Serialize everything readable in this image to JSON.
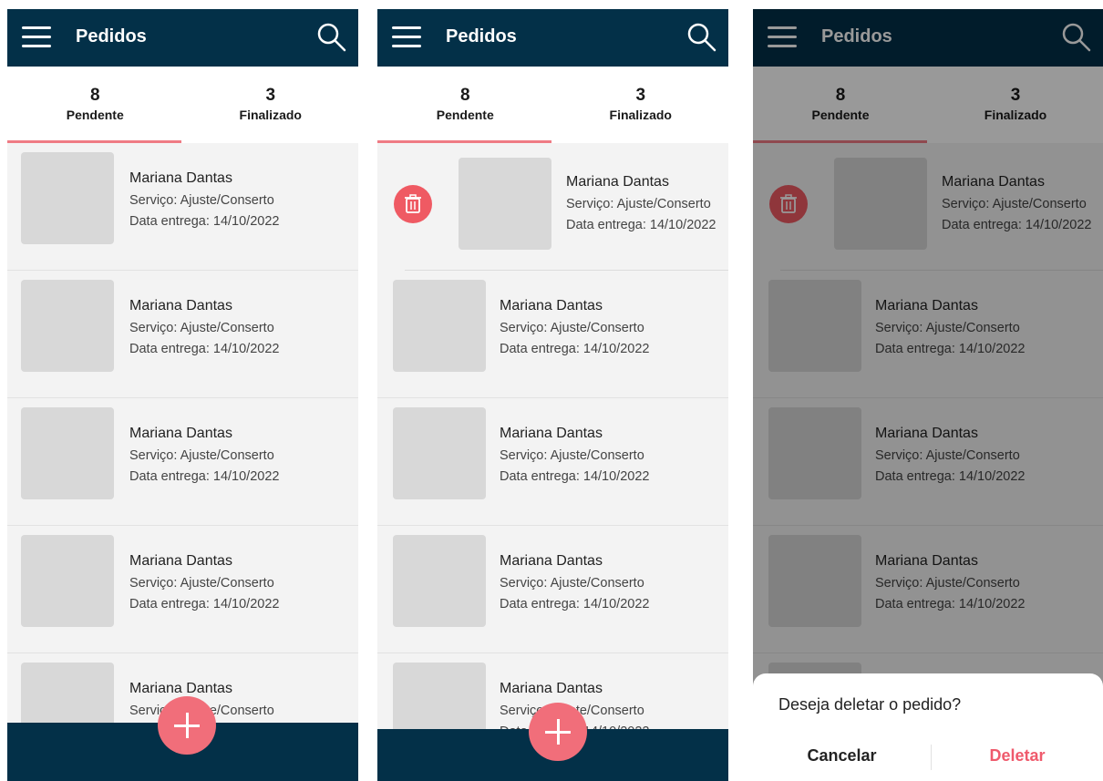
{
  "colors": {
    "appbar": "#033048",
    "accent": "#ef7b84",
    "fab": "#f16e7a",
    "delete": "#ef5a63",
    "background": "#f3f3f3"
  },
  "appbar": {
    "title": "Pedidos",
    "menu_icon": "hamburger-menu-icon",
    "search_icon": "search-icon"
  },
  "tabs": [
    {
      "count": "8",
      "label": "Pendente"
    },
    {
      "count": "3",
      "label": "Finalizado"
    }
  ],
  "order": {
    "name": "Mariana Dantas",
    "service": "Serviço: Ajuste/Conserto",
    "delivery": "Data entrega: 14/10/2022"
  },
  "fab_icon": "plus-icon",
  "delete_icon": "trash-icon",
  "dialog": {
    "message": "Deseja deletar o pedido?",
    "cancel": "Cancelar",
    "confirm": "Deletar"
  }
}
